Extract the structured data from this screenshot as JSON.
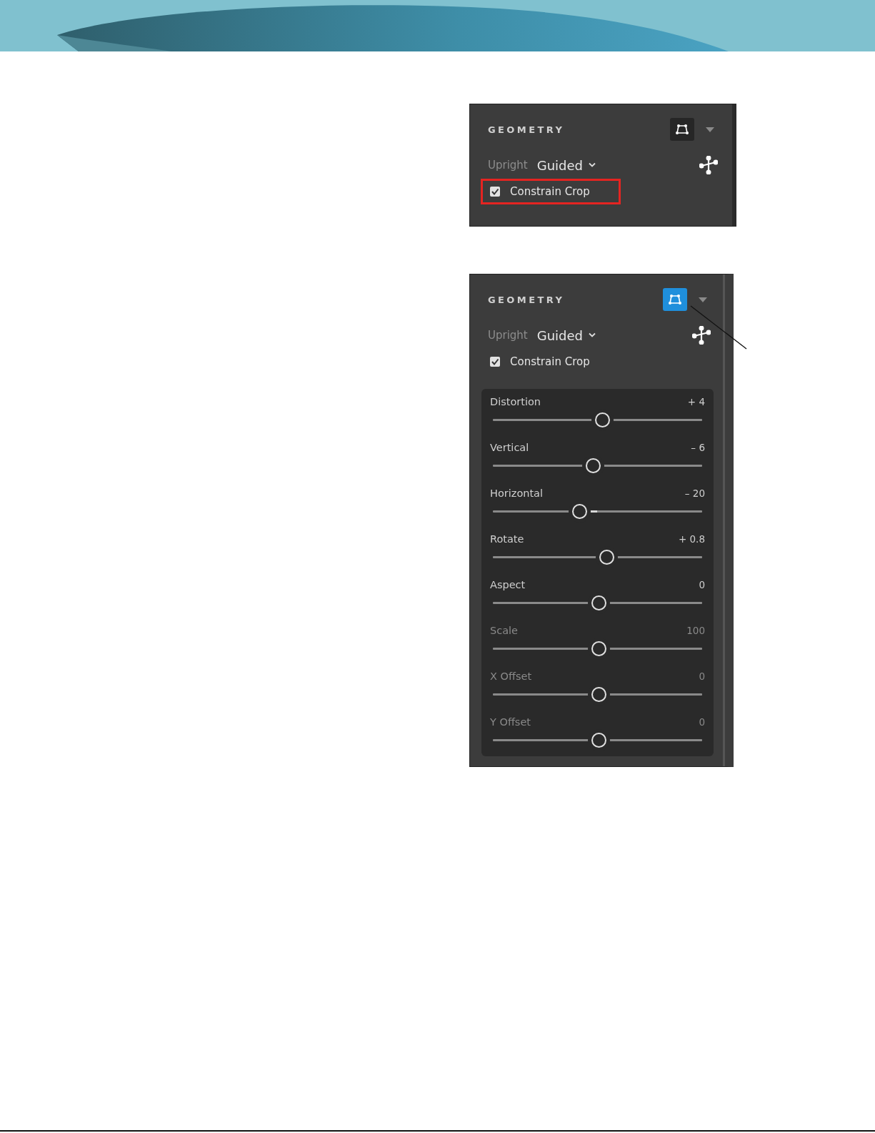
{
  "panels": [
    {
      "title": "GEOMETRY",
      "tool_selected": false,
      "upright_label": "Upright",
      "upright_value": "Guided",
      "constrain_crop": {
        "label": "Constrain Crop",
        "checked": true,
        "highlighted": true
      },
      "leader_line": false
    },
    {
      "title": "GEOMETRY",
      "tool_selected": true,
      "upright_label": "Upright",
      "upright_value": "Guided",
      "constrain_crop": {
        "label": "Constrain Crop",
        "checked": true,
        "highlighted": false
      },
      "leader_line": true,
      "sliders": [
        {
          "label": "Distortion",
          "reading": "+ 4",
          "level": 0.51,
          "disabled": false
        },
        {
          "label": "Vertical",
          "reading": "– 6",
          "level": 0.47,
          "disabled": false
        },
        {
          "label": "Horizontal",
          "reading": "– 20",
          "level": 0.405,
          "disabled": false
        },
        {
          "label": "Rotate",
          "reading": "+ 0.8",
          "level": 0.53,
          "disabled": false
        },
        {
          "label": "Aspect",
          "reading": "0",
          "level": 0.495,
          "disabled": false
        },
        {
          "label": "Scale",
          "reading": "100",
          "level": 0.495,
          "disabled": true
        },
        {
          "label": "X Offset",
          "reading": "0",
          "level": 0.495,
          "disabled": true
        },
        {
          "label": "Y Offset",
          "reading": "0",
          "level": 0.495,
          "disabled": true
        }
      ]
    }
  ]
}
